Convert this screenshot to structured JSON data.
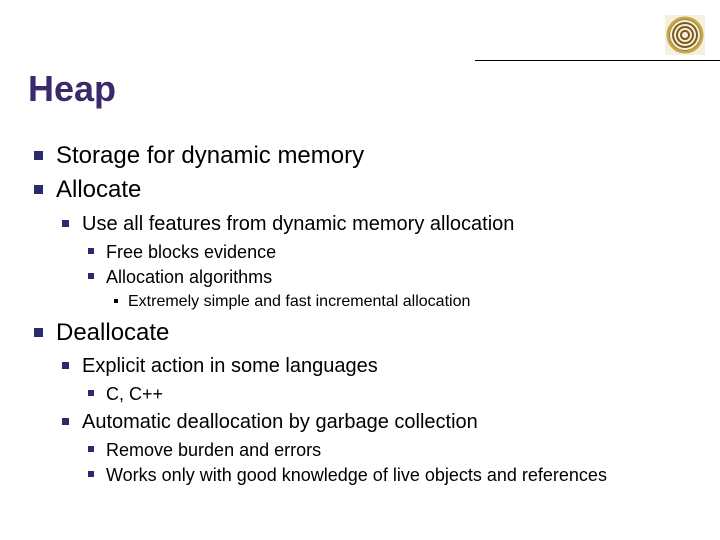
{
  "title": "Heap",
  "bullets": {
    "l1_0": "Storage for dynamic memory",
    "l1_1": "Allocate",
    "l1_1_l2_0": "Use all features from dynamic memory allocation",
    "l1_1_l2_0_l3_0": "Free blocks evidence",
    "l1_1_l2_0_l3_1": "Allocation algorithms",
    "l1_1_l2_0_l3_1_l4_0": "Extremely simple and fast incremental allocation",
    "l1_2": "Deallocate",
    "l1_2_l2_0": "Explicit action in some languages",
    "l1_2_l2_0_l3_0": "C, C++",
    "l1_2_l2_1": "Automatic deallocation by garbage collection",
    "l1_2_l2_1_l3_0": "Remove burden and errors",
    "l1_2_l2_1_l3_1": "Works only with good knowledge of live objects and references"
  },
  "logo_name": "spiral-shell-icon"
}
